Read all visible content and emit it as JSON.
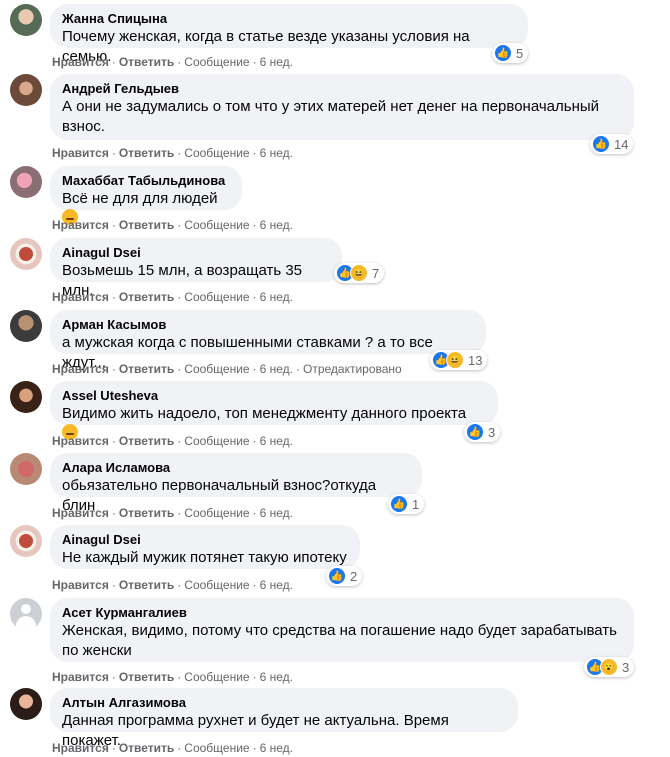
{
  "actions": {
    "like": "Нравится",
    "reply": "Ответить",
    "message": "Сообщение",
    "dot": "·",
    "time": "6 нед.",
    "edited": "Отредактировано"
  },
  "comments": [
    {
      "author": "Жанна Спицына",
      "text": "Почему женская, когда в статье везде указаны условия на семью.",
      "reactions": [
        "like"
      ],
      "count": "5"
    },
    {
      "author": "Андрей Гельдыев",
      "text": "А они не задумались о том что у этих матерей нет денег на первоначальный\nвзнос.",
      "reactions": [
        "like"
      ],
      "count": "14"
    },
    {
      "author": "Махаббат Табыльдинова",
      "text": "Всё не для для людей",
      "emoji": "unamused-face"
    },
    {
      "author": "Ainagul Dsei",
      "text": "Возьмешь 15 млн, а возращать 35 млн.",
      "reactions": [
        "like",
        "haha"
      ],
      "count": "7"
    },
    {
      "author": "Арман Касымов",
      "text": "а мужская когда с повышенными ставками ? а то все ждут...",
      "reactions": [
        "like",
        "haha"
      ],
      "count": "13"
    },
    {
      "author": "Assel Utesheva",
      "text": "Видимо жить надоело, топ менеджменту данного проекта",
      "emoji": "grinning-face",
      "reactions": [
        "like"
      ],
      "count": "3"
    },
    {
      "author": "Алара Исламова",
      "text": "обьязательно первоначальный взнос?откуда блин",
      "reactions": [
        "like"
      ],
      "count": "1"
    },
    {
      "author": "Ainagul Dsei",
      "text": "Не каждый мужик потянет такую ипотеку",
      "reactions": [
        "like"
      ],
      "count": "2"
    },
    {
      "author": "Асет Курмангалиев",
      "text": "Женская, видимо, потому что средства на погашение надо будет зарабатывать\nпо женски",
      "reactions": [
        "like",
        "wow"
      ],
      "count": "3"
    },
    {
      "author": "Алтын Алгазимова",
      "text": "Данная программа рухнет и будет не актуальна. Время покажет."
    }
  ]
}
